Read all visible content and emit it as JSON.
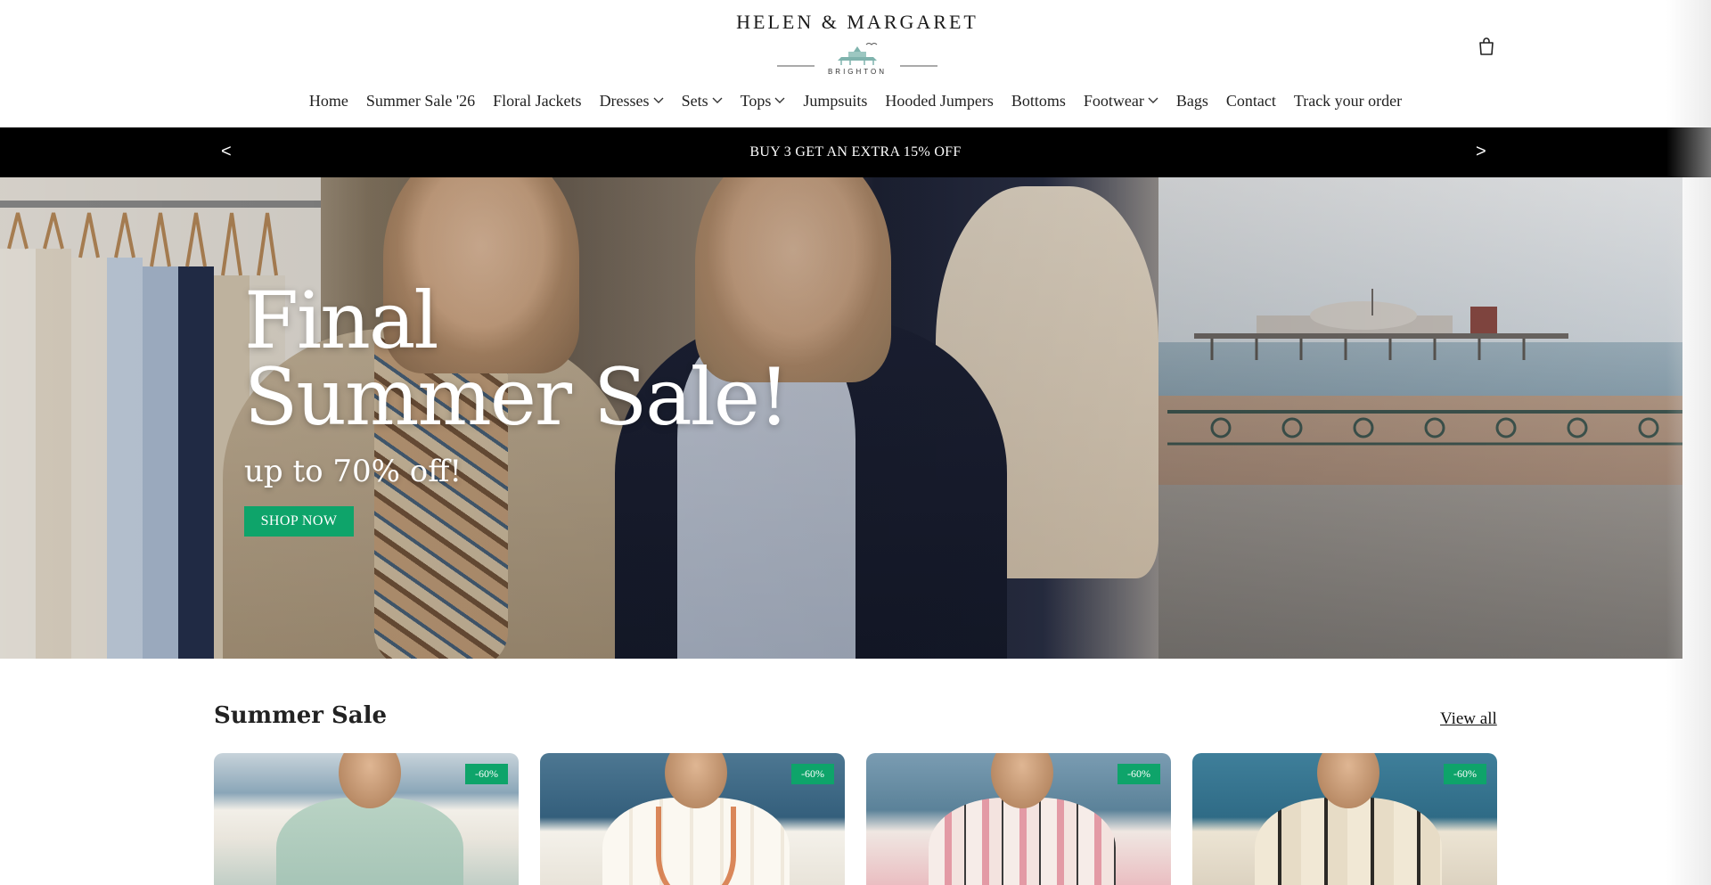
{
  "header": {
    "logo": {
      "title": "HELEN & MARGARET",
      "subtitle": "BRIGHTON"
    },
    "cart_icon": "shopping-bag-icon",
    "nav": [
      {
        "label": "Home",
        "has_dropdown": false
      },
      {
        "label": "Summer Sale '26",
        "has_dropdown": false
      },
      {
        "label": "Floral Jackets",
        "has_dropdown": false
      },
      {
        "label": "Dresses",
        "has_dropdown": true
      },
      {
        "label": "Sets",
        "has_dropdown": true
      },
      {
        "label": "Tops",
        "has_dropdown": true
      },
      {
        "label": "Jumpsuits",
        "has_dropdown": false
      },
      {
        "label": "Hooded Jumpers",
        "has_dropdown": false
      },
      {
        "label": "Bottoms",
        "has_dropdown": false
      },
      {
        "label": "Footwear",
        "has_dropdown": true
      },
      {
        "label": "Bags",
        "has_dropdown": false
      },
      {
        "label": "Contact",
        "has_dropdown": false
      },
      {
        "label": "Track your order",
        "has_dropdown": false
      }
    ]
  },
  "announcement": {
    "prev_label": "<",
    "text": "BUY 3 GET AN EXTRA 15% OFF",
    "next_label": ">"
  },
  "hero": {
    "title_line1": "Final",
    "title_line2": "Summer Sale!",
    "subtitle": "up to 70% off!",
    "button_label": "SHOP NOW"
  },
  "summer_sale": {
    "title": "Summer Sale",
    "view_all_label": "View all",
    "products": [
      {
        "badge": "-60%"
      },
      {
        "badge": "-60%"
      },
      {
        "badge": "-60%"
      },
      {
        "badge": "-60%"
      }
    ]
  },
  "colors": {
    "accent_green": "#0ea46a",
    "announcement_bg": "#000000",
    "text_dark": "#222222"
  }
}
